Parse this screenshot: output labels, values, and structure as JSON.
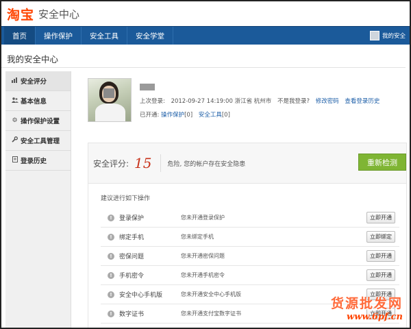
{
  "header": {
    "logo_text": "淘宝",
    "subtitle": "安全中心"
  },
  "nav": {
    "items": [
      {
        "label": "首页"
      },
      {
        "label": "操作保护"
      },
      {
        "label": "安全工具"
      },
      {
        "label": "安全学堂"
      }
    ],
    "user_text": "我的安全"
  },
  "page": {
    "title": "我的安全中心"
  },
  "sidebar": {
    "items": [
      {
        "label": "安全评分",
        "icon": "bar-chart-icon"
      },
      {
        "label": "基本信息",
        "icon": "users-icon"
      },
      {
        "label": "操作保护设置",
        "icon": "gear-icon"
      },
      {
        "label": "安全工具管理",
        "icon": "wrench-icon"
      },
      {
        "label": "登录历史",
        "icon": "document-icon"
      }
    ]
  },
  "profile": {
    "last_login_label": "上次登录:",
    "last_login_time": "2012-09-27 14:19:00",
    "last_login_location": "浙江省 杭州市",
    "not_me_text": "不是我登录?",
    "change_password_link": "修改密码",
    "login_history_link": "查看登录历史",
    "enabled_label": "已开通:",
    "enabled_op_protect": "操作保护",
    "enabled_op_protect_count": "[0]",
    "enabled_security_tools": "安全工具",
    "enabled_security_tools_count": "[0]"
  },
  "score": {
    "label": "安全评分:",
    "value": "15",
    "message": "危险, 您的帐户存在安全隐患",
    "recheck_button": "重新检测"
  },
  "operations": {
    "title": "建议进行如下操作",
    "rows": [
      {
        "name": "登录保护",
        "desc": "您未开通登录保护",
        "button": "立即开通"
      },
      {
        "name": "绑定手机",
        "desc": "您未绑定手机",
        "button": "立即绑定"
      },
      {
        "name": "密保问题",
        "desc": "您未开通密保问题",
        "button": "立即开通"
      },
      {
        "name": "手机密令",
        "desc": "您未开通手机密令",
        "button": "立即开通"
      },
      {
        "name": "安全中心手机版",
        "desc": "您未开通安全中心手机版",
        "button": "立即开通"
      },
      {
        "name": "数字证书",
        "desc": "您未开通支付宝数字证书",
        "button": "立即开通"
      }
    ]
  },
  "watermark": {
    "main": "货源批发网",
    "sub": "www.6pf.cn"
  }
}
